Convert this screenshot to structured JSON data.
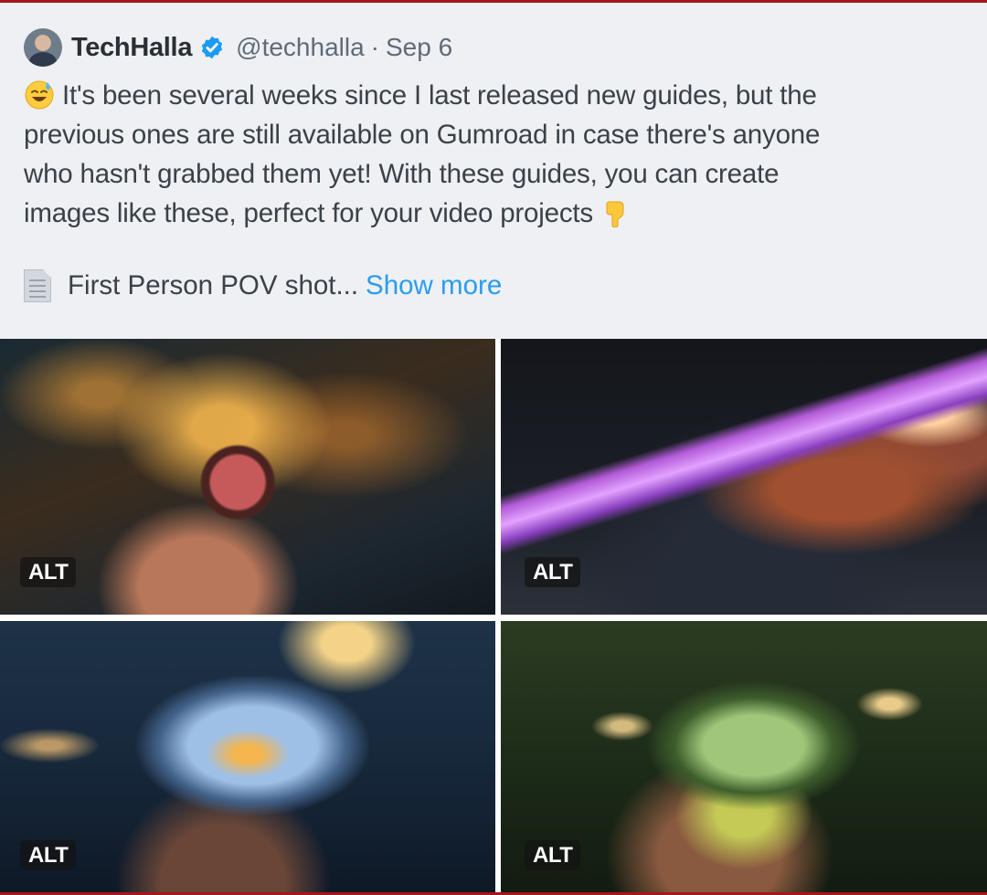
{
  "tweet": {
    "author_name": "TechHalla",
    "handle": "@techhalla",
    "separator": "·",
    "date": "Sep 6",
    "verified": true,
    "text_lines": [
      "It's been several weeks since I last released new guides, but the",
      "previous ones are still available on Gumroad in case there's anyone",
      "who hasn't grabbed them yet! With these guides, you can create",
      "images like these, perfect for your video projects"
    ],
    "emoji_start": "sweat-smile-emoji",
    "emoji_end": "pointing-down-emoji",
    "second_paragraph": "First Person POV shot...",
    "doc_icon": "page-facing-up-emoji",
    "show_more": "Show more"
  },
  "media": {
    "alt_label": "ALT",
    "images": [
      {
        "name": "pocket-watch-image",
        "alt": "ALT"
      },
      {
        "name": "crystal-wand-image",
        "alt": "ALT"
      },
      {
        "name": "crystal-skull-image",
        "alt": "ALT"
      },
      {
        "name": "crystal-heart-image",
        "alt": "ALT"
      }
    ]
  },
  "colors": {
    "link": "#2b9cf0",
    "verified": "#1d9bf0",
    "text": "#3b4148",
    "muted": "#5f6b78",
    "frame_border": "#a3181c"
  }
}
